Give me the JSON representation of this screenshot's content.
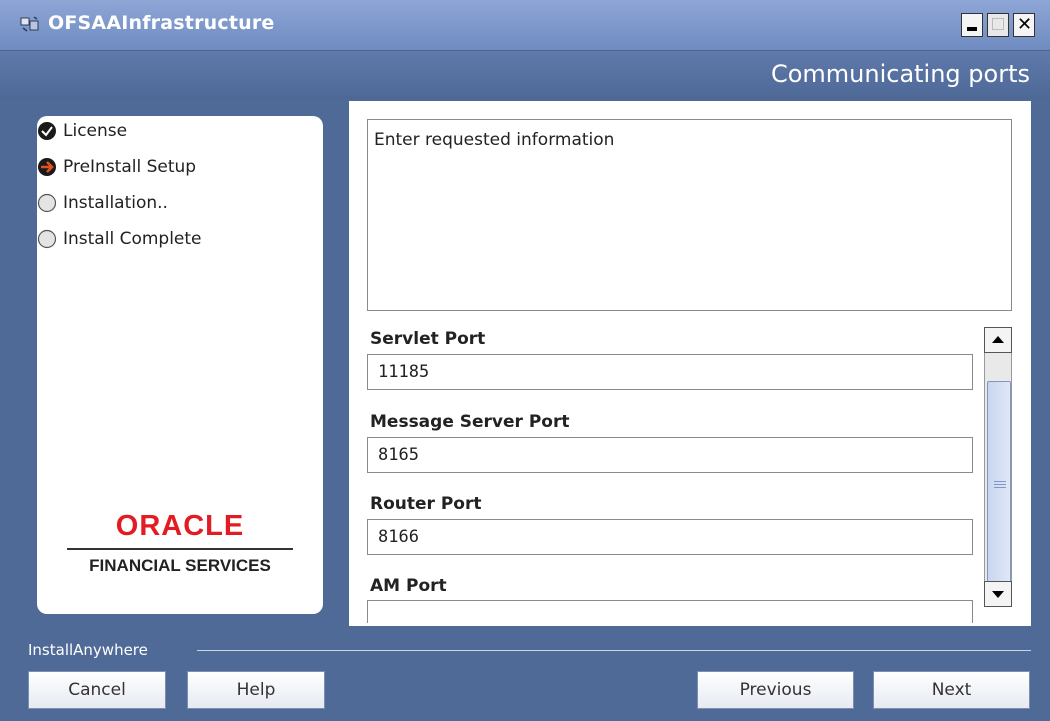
{
  "window": {
    "title": "OFSAAInfrastructure"
  },
  "header": {
    "title": "Communicating ports"
  },
  "steps": [
    {
      "label": "License",
      "state": "done"
    },
    {
      "label": "PreInstall Setup",
      "state": "current"
    },
    {
      "label": "Installation..",
      "state": "pending"
    },
    {
      "label": "Install Complete",
      "state": "pending"
    }
  ],
  "logo": {
    "brand": "ORACLE",
    "subtitle": "FINANCIAL SERVICES"
  },
  "info": {
    "text": "Enter requested information"
  },
  "fields": [
    {
      "label": "Servlet Port",
      "value": "11185"
    },
    {
      "label": "Message Server Port",
      "value": "8165"
    },
    {
      "label": "Router Port",
      "value": "8166"
    },
    {
      "label": "AM Port",
      "value": ""
    }
  ],
  "footer": {
    "brand": "InstallAnywhere",
    "cancel": "Cancel",
    "help": "Help",
    "previous": "Previous",
    "next": "Next"
  },
  "colors": {
    "title_bar": "#7b96c9",
    "background": "#4f6a96",
    "oracle_red": "#e31b23",
    "step_current_arrow": "#e0521f"
  }
}
